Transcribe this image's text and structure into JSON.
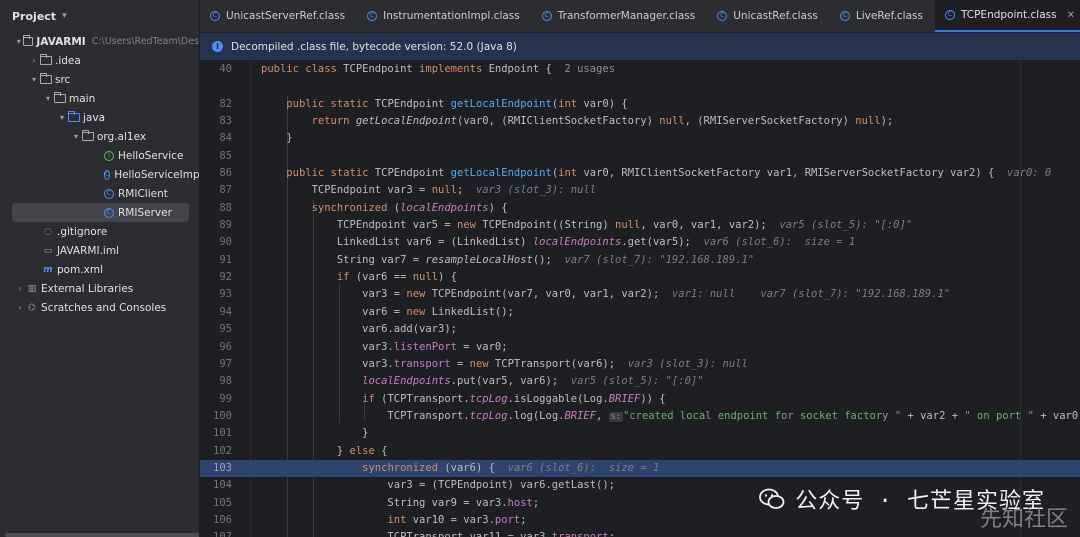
{
  "sidebar": {
    "title": "Project",
    "root": {
      "name": "JAVARMI",
      "path": "C:\\Users\\RedTeam\\Des"
    },
    "items": {
      "idea": ".idea",
      "src": "src",
      "main": "main",
      "java": "java",
      "pkg": "org.al1ex",
      "c1": "HelloService",
      "c2": "HelloServiceImpl",
      "c3": "RMIClient",
      "c4": "RMIServer",
      "gitignore": ".gitignore",
      "iml": "JAVARMI.iml",
      "pom": "pom.xml",
      "libs": "External Libraries",
      "scratches": "Scratches and Consoles"
    }
  },
  "tabs": [
    {
      "label": "UnicastServerRef.class"
    },
    {
      "label": "InstrumentationImpl.class"
    },
    {
      "label": "TransformerManager.class"
    },
    {
      "label": "UnicastRef.class"
    },
    {
      "label": "LiveRef.class"
    },
    {
      "label": "TCPEndpoint.class",
      "active": true
    }
  ],
  "banner": {
    "text": "Decompiled .class file, bytecode version: 52.0 (Java 8)"
  },
  "editor": {
    "current_line": "103",
    "usages": "2 usages",
    "line_numbers": [
      "40",
      "82",
      "83",
      "84",
      "85",
      "86",
      "87",
      "88",
      "89",
      "90",
      "91",
      "92",
      "93",
      "94",
      "95",
      "96",
      "97",
      "98",
      "99",
      "100",
      "101",
      "102",
      "103",
      "104",
      "105",
      "106",
      "107"
    ],
    "hints": {
      "h86": "var0: 0",
      "h87": "var3 (slot_3): null",
      "h89": "var5 (slot_5): \"[:0]\"",
      "h90": "var6 (slot_6):  size = 1",
      "h91": "var7 (slot_7): \"192.168.189.1\"",
      "h93a": "var1: null",
      "h93b": "var7 (slot_7): \"192.168.189.1\"",
      "h97": "var3 (slot_3): null",
      "h98": "var5 (slot_5): \"[:0]\"",
      "h100_inlay": "s:",
      "h103": "var6 (slot_6):  size = 1"
    },
    "strings": {
      "s1": "\"[:0]\"",
      "s100a": "\"created local endpoint for socket factory \"",
      "s100b": "\" on port \""
    }
  },
  "watermark": {
    "text": "公众号 · 七芒星实验室",
    "logo_text": "先知社区"
  },
  "colors": {
    "accent": "#3574f0",
    "keyword": "#cf8e6d",
    "function": "#56a8f5",
    "field": "#c77dbb",
    "string": "#6aab73"
  }
}
